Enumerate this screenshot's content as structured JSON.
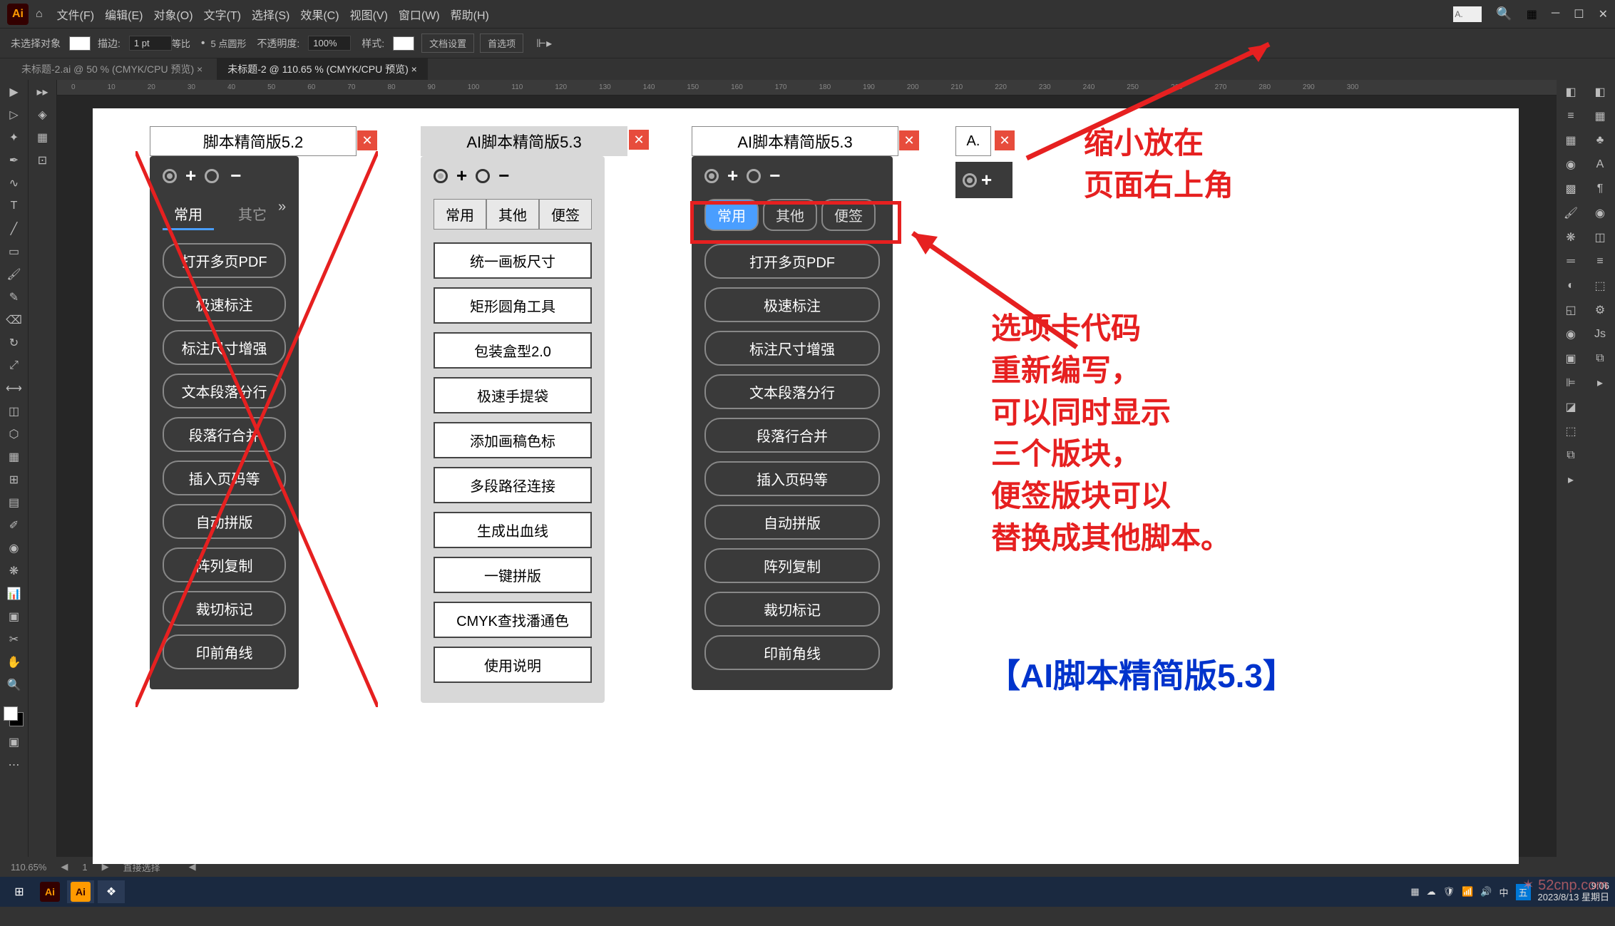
{
  "menubar": {
    "items": [
      "文件(F)",
      "编辑(E)",
      "对象(O)",
      "文字(T)",
      "选择(S)",
      "效果(C)",
      "视图(V)",
      "窗口(W)",
      "帮助(H)"
    ]
  },
  "optionsbar": {
    "no_selection": "未选择对象",
    "stroke_label": "描边:",
    "stroke_value": "1 pt",
    "uniform": "等比",
    "dash_label": "5 点圆形",
    "opacity_label": "不透明度:",
    "opacity_value": "100%",
    "style_label": "样式:",
    "doc_setup": "文档设置",
    "prefs": "首选项"
  },
  "tabs": {
    "t1": "未标题-2.ai @ 50 % (CMYK/CPU 预览)",
    "t2": "未标题-2 @ 110.65 % (CMYK/CPU 预览)"
  },
  "ruler_marks": [
    "0",
    "10",
    "20",
    "30",
    "40",
    "50",
    "60",
    "70",
    "80",
    "90",
    "100",
    "110",
    "120",
    "130",
    "140",
    "150",
    "160",
    "170",
    "180",
    "190",
    "200",
    "210",
    "220",
    "230",
    "240",
    "250",
    "260",
    "270",
    "280",
    "290",
    "300"
  ],
  "panel52": {
    "title": "脚本精简版5.2",
    "tabs": [
      "常用",
      "其它"
    ],
    "buttons": [
      "打开多页PDF",
      "极速标注",
      "标注尺寸增强",
      "文本段落分行",
      "段落行合并",
      "插入页码等",
      "自动拼版",
      "阵列复制",
      "裁切标记",
      "印前角线"
    ]
  },
  "panel53_light": {
    "title": "AI脚本精简版5.3",
    "tabs": [
      "常用",
      "其他",
      "便签"
    ],
    "buttons": [
      "统一画板尺寸",
      "矩形圆角工具",
      "包装盒型2.0",
      "极速手提袋",
      "添加画稿色标",
      "多段路径连接",
      "生成出血线",
      "一键拼版",
      "CMYK查找潘通色",
      "使用说明"
    ]
  },
  "panel53_dark": {
    "title": "AI脚本精简版5.3",
    "tabs": [
      "常用",
      "其他",
      "便签"
    ],
    "buttons": [
      "打开多页PDF",
      "极速标注",
      "标注尺寸增强",
      "文本段落分行",
      "段落行合并",
      "插入页码等",
      "自动拼版",
      "阵列复制",
      "裁切标记",
      "印前角线"
    ]
  },
  "mini_panel": {
    "title": "A."
  },
  "minimized_label": "A.",
  "annotations": {
    "top": "缩小放在\n页面右上角",
    "mid": "选项卡代码\n重新编写，\n可以同时显示\n三个版块，\n便签版块可以\n替换成其他脚本。",
    "bottom": "【AI脚本精简版5.3】"
  },
  "status": {
    "zoom": "110.65%",
    "sel": "直接选择"
  },
  "taskbar": {
    "time": "9:06",
    "date": "2023/8/13 星期日",
    "watermark": "52cnp.com"
  }
}
